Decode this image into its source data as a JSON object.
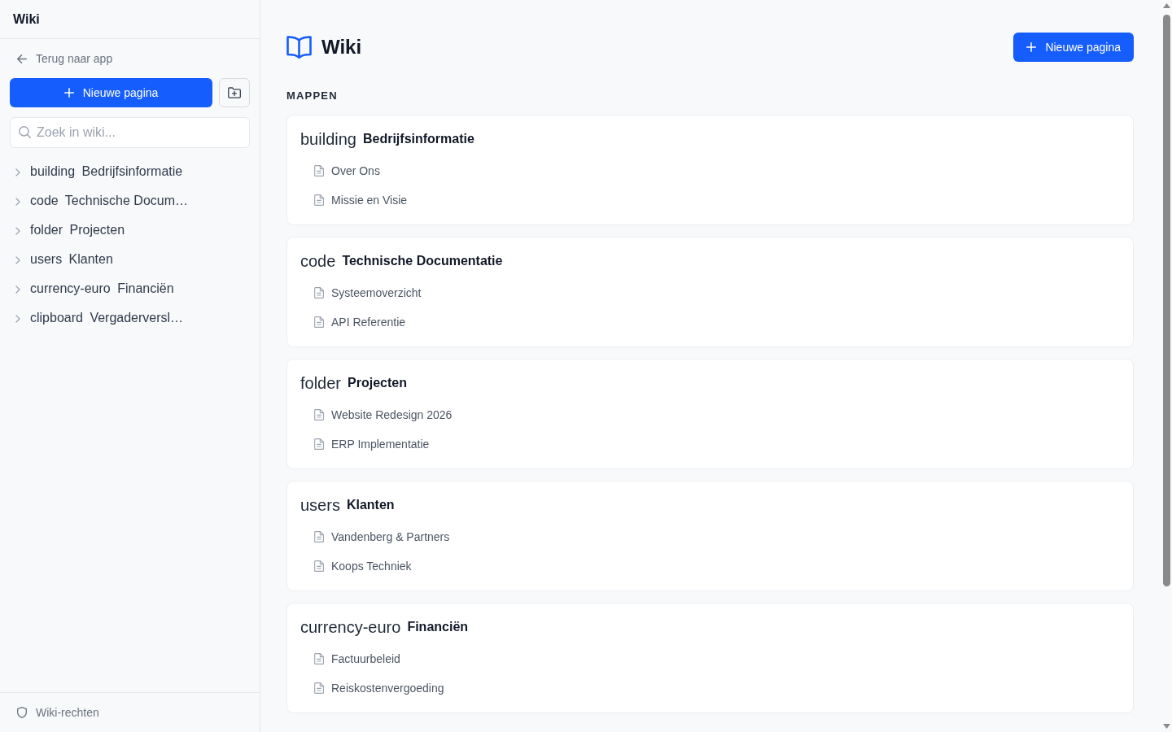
{
  "sidebar": {
    "title": "Wiki",
    "back_link": "Terug naar app",
    "new_page_button": "Nieuwe pagina",
    "search": {
      "placeholder": "Zoek in wiki..."
    },
    "tree": [
      {
        "icon_name": "building",
        "label": "Bedrijfsinformatie",
        "expanded": false
      },
      {
        "icon_name": "code",
        "label": "Technische Docum…",
        "expanded": false
      },
      {
        "icon_name": "folder",
        "label": "Projecten",
        "expanded": false
      },
      {
        "icon_name": "users",
        "label": "Klanten",
        "expanded": false
      },
      {
        "icon_name": "currency-euro",
        "label": "Financiën",
        "expanded": false
      },
      {
        "icon_name": "clipboard",
        "label": "Vergaderversl…",
        "expanded": false
      }
    ],
    "footer_link": "Wiki-rechten"
  },
  "main": {
    "title": "Wiki",
    "new_page_button": "Nieuwe pagina",
    "section_label": "MAPPEN",
    "folders": [
      {
        "icon_name": "building",
        "title": "Bedrijfsinformatie",
        "pages": [
          "Over Ons",
          "Missie en Visie"
        ]
      },
      {
        "icon_name": "code",
        "title": "Technische Documentatie",
        "pages": [
          "Systeemoverzicht",
          "API Referentie"
        ]
      },
      {
        "icon_name": "folder",
        "title": "Projecten",
        "pages": [
          "Website Redesign 2026",
          "ERP Implementatie"
        ]
      },
      {
        "icon_name": "users",
        "title": "Klanten",
        "pages": [
          "Vandenberg & Partners",
          "Koops Techniek"
        ]
      },
      {
        "icon_name": "currency-euro",
        "title": "Financiën",
        "pages": [
          "Factuurbeleid",
          "Reiskostenvergoeding"
        ]
      }
    ]
  }
}
